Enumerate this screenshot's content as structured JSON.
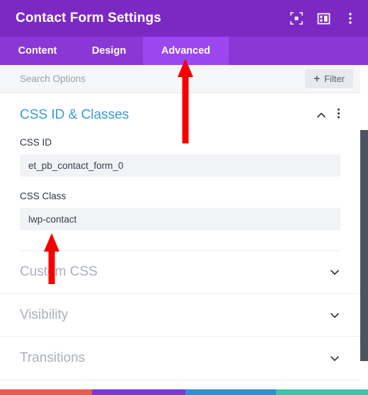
{
  "header": {
    "title": "Contact Form Settings",
    "actions": [
      {
        "name": "focus-mode-icon",
        "label": "Focus Mode"
      },
      {
        "name": "layout-view-icon",
        "label": "Layout View"
      },
      {
        "name": "more-options-icon",
        "label": "More Options"
      }
    ]
  },
  "tabs": [
    {
      "label": "Content",
      "active": false
    },
    {
      "label": "Design",
      "active": false
    },
    {
      "label": "Advanced",
      "active": true
    }
  ],
  "search": {
    "placeholder": "Search Options",
    "value": "",
    "filter_label": "Filter",
    "filter_plus": "+"
  },
  "sections": {
    "css_id_classes": {
      "title": "CSS ID & Classes",
      "expanded": true,
      "fields": [
        {
          "label": "CSS ID",
          "value": "et_pb_contact_form_0",
          "placeholder": ""
        },
        {
          "label": "CSS Class",
          "value": "lwp-contact",
          "placeholder": ""
        }
      ]
    },
    "collapsed": [
      {
        "title": "Custom CSS"
      },
      {
        "title": "Visibility"
      },
      {
        "title": "Transitions"
      }
    ]
  },
  "bottom_bar": {
    "segments": [
      {
        "color": "#ea5a4e",
        "width": 130
      },
      {
        "color": "#7c3ad4",
        "width": 132
      },
      {
        "color": "#2d8fd5",
        "width": 128
      },
      {
        "color": "#3ec3a8",
        "width": 130
      }
    ]
  },
  "annotations": {
    "arrow_color": "#f80000",
    "arrows": [
      {
        "name": "arrow-to-advanced-tab",
        "points_to": "Advanced"
      },
      {
        "name": "arrow-to-css-class-field",
        "points_to": "CSS Class"
      }
    ]
  },
  "colors": {
    "header_purple": "#7c29c4",
    "tab_purple": "#8b37d6",
    "tab_active_purple": "#9b46ef",
    "section_title_blue": "#3a9ad9",
    "scrollbar": "#4d5562"
  }
}
